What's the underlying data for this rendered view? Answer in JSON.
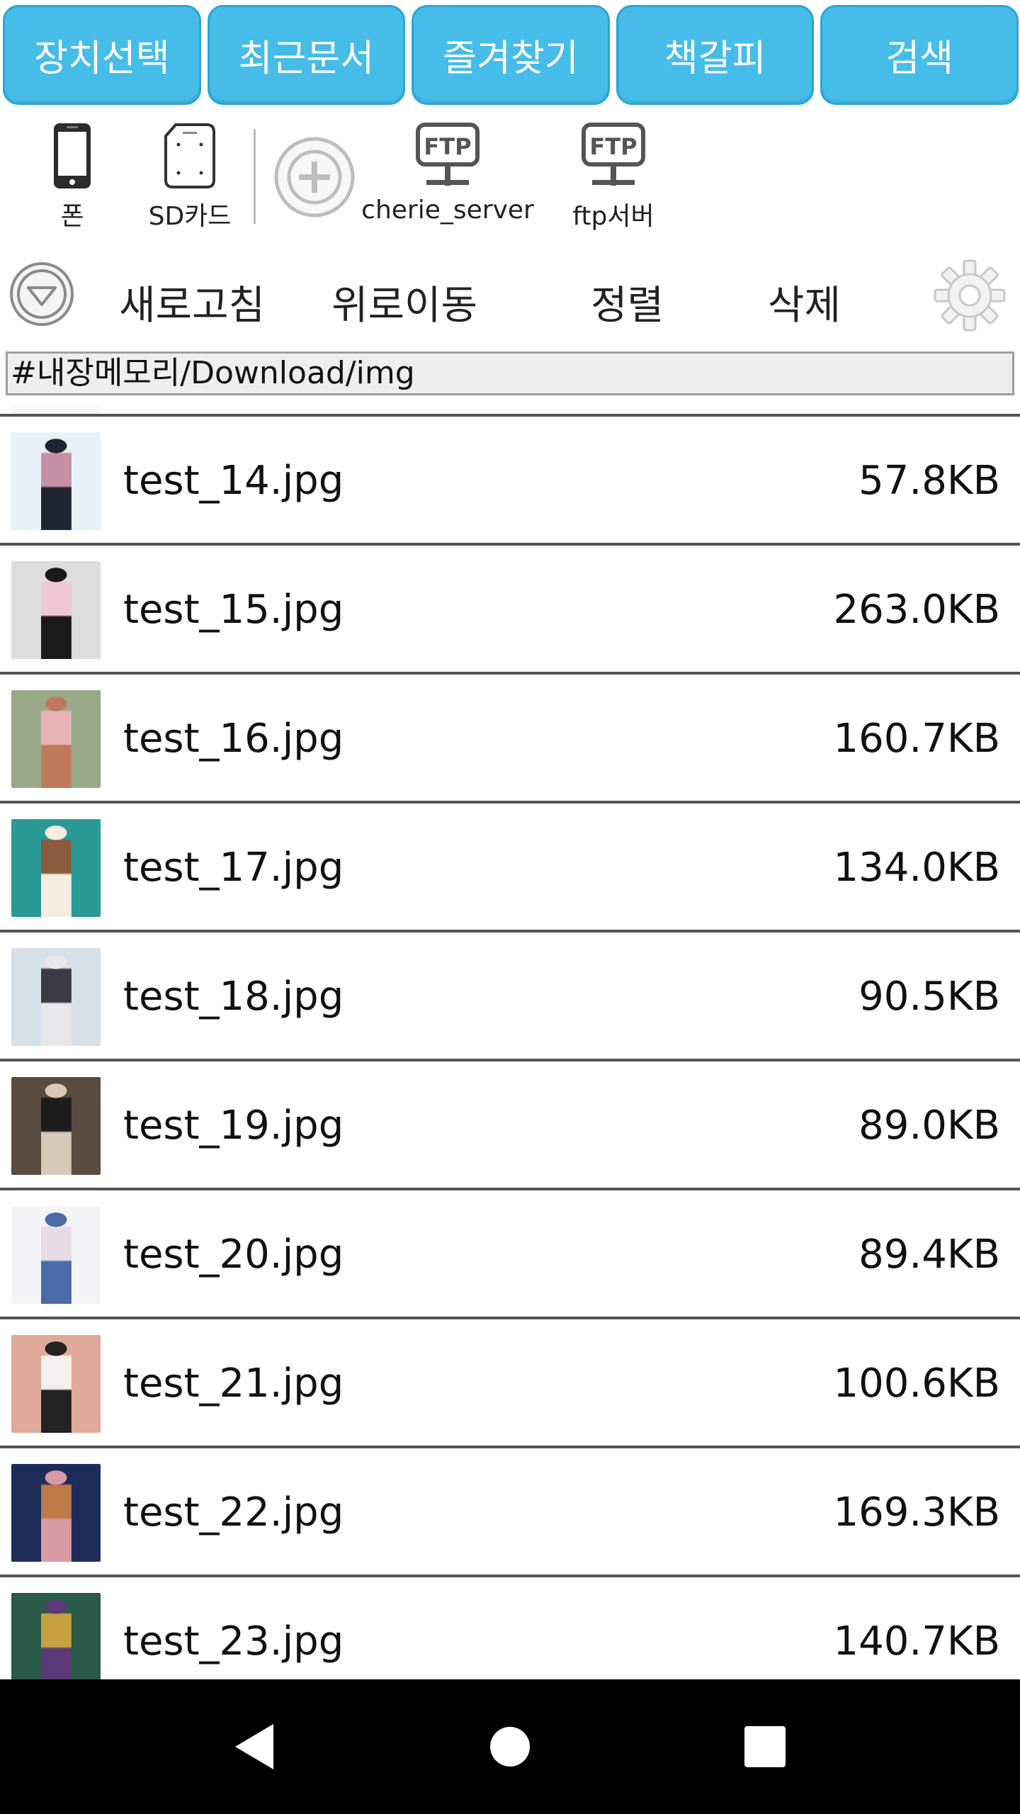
{
  "tabs": [
    "장치선택",
    "최근문서",
    "즐겨찾기",
    "책갈피",
    "검색"
  ],
  "devices": [
    {
      "label": "폰",
      "icon": "phone-icon"
    },
    {
      "label": "SD카드",
      "icon": "sd-card-icon"
    },
    {
      "label": "",
      "icon": "add-device-icon"
    },
    {
      "label": "cherie_server",
      "icon": "ftp-icon"
    },
    {
      "label": "ftp서버",
      "icon": "ftp-icon"
    }
  ],
  "ftp_badge": "FTP",
  "actions": {
    "refresh": "새로고침",
    "up": "위로이동",
    "sort": "정렬",
    "delete": "삭제"
  },
  "path": "#내장메모리/Download/img",
  "files": [
    {
      "name": "test_14.jpg",
      "size": "57.8KB",
      "thumb_colors": [
        "#e8f0f8",
        "#c58fa6",
        "#1e2430"
      ]
    },
    {
      "name": "test_15.jpg",
      "size": "263.0KB",
      "thumb_colors": [
        "#dcdcdc",
        "#f0c8d6",
        "#1a1a1a"
      ]
    },
    {
      "name": "test_16.jpg",
      "size": "160.7KB",
      "thumb_colors": [
        "#9aa88a",
        "#e8b4b8",
        "#c0785a"
      ]
    },
    {
      "name": "test_17.jpg",
      "size": "134.0KB",
      "thumb_colors": [
        "#2a9a96",
        "#8a5a3c",
        "#f4ede0"
      ]
    },
    {
      "name": "test_18.jpg",
      "size": "90.5KB",
      "thumb_colors": [
        "#d6e0e8",
        "#3a3a44",
        "#e8e8ec"
      ]
    },
    {
      "name": "test_19.jpg",
      "size": "89.0KB",
      "thumb_colors": [
        "#5a4a40",
        "#1c1c1c",
        "#d8c8b8"
      ]
    },
    {
      "name": "test_20.jpg",
      "size": "89.4KB",
      "thumb_colors": [
        "#f4f4f6",
        "#e8dce4",
        "#4a6aa8"
      ]
    },
    {
      "name": "test_21.jpg",
      "size": "100.6KB",
      "thumb_colors": [
        "#e0a898",
        "#f4f0f0",
        "#222222"
      ]
    },
    {
      "name": "test_22.jpg",
      "size": "169.3KB",
      "thumb_colors": [
        "#1e2c5a",
        "#c07848",
        "#d89aa4"
      ]
    },
    {
      "name": "test_23.jpg",
      "size": "140.7KB",
      "thumb_colors": [
        "#2a5a48",
        "#c8a040",
        "#5a3a78"
      ]
    }
  ],
  "colors": {
    "tab_bg": "#45bde8",
    "tab_border": "#2aa6d6",
    "row_divider": "#555555",
    "nav_bg": "#000000"
  }
}
